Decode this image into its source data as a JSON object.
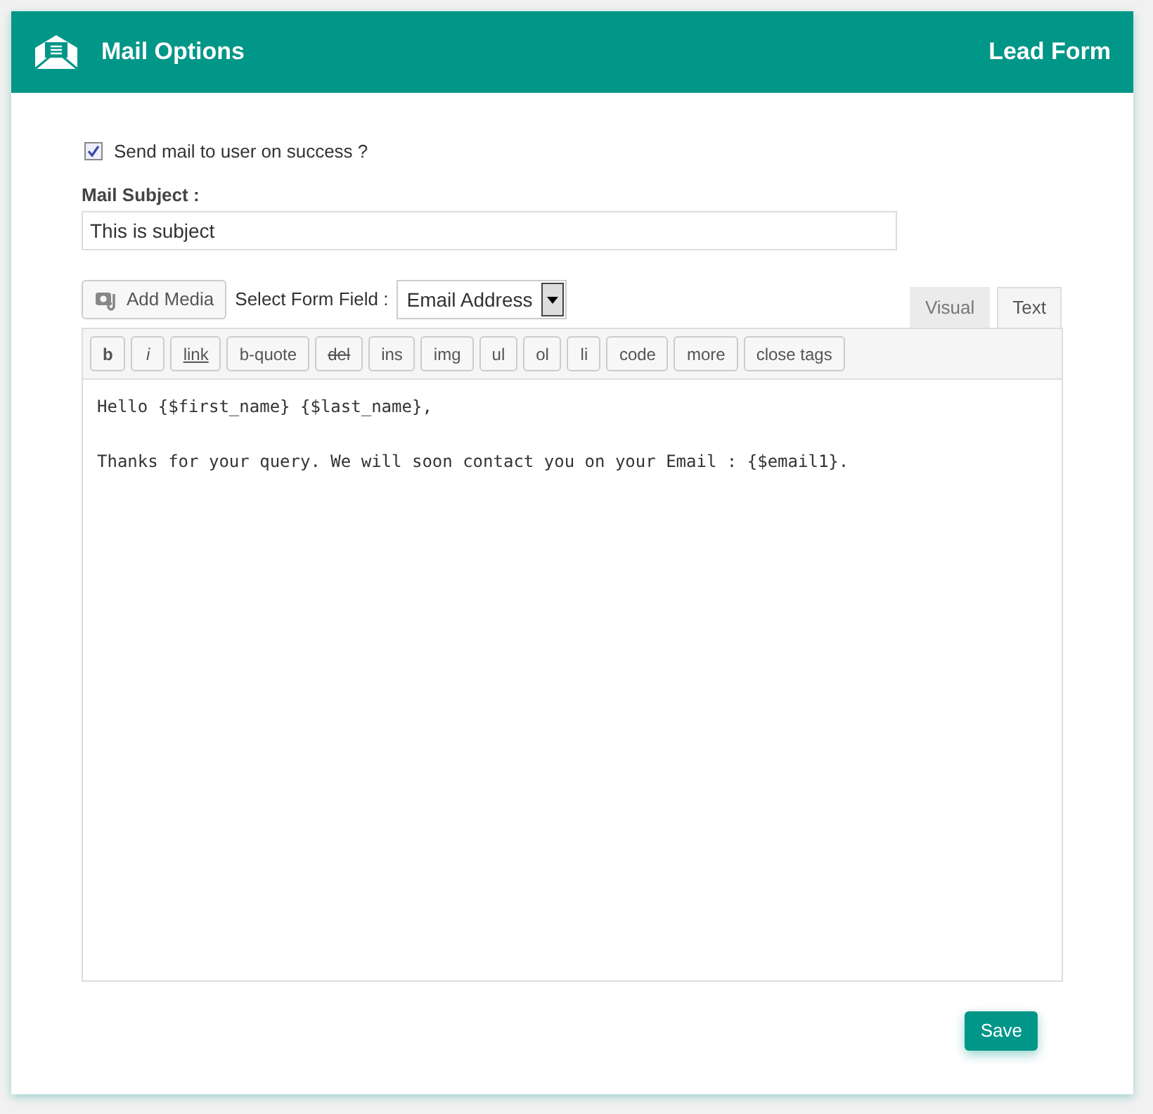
{
  "header": {
    "title": "Mail Options",
    "form_name": "Lead Form"
  },
  "send_mail": {
    "label": "Send mail to user on success ?",
    "checked": true
  },
  "subject": {
    "label": "Mail Subject :",
    "value": "This is subject"
  },
  "add_media": "Add Media",
  "form_field": {
    "label": "Select Form Field :",
    "value": "Email Address"
  },
  "tabs": [
    {
      "label": "Visual",
      "selected": false
    },
    {
      "label": "Text",
      "selected": true
    }
  ],
  "quicktags": [
    {
      "label": "b",
      "kind": "bold"
    },
    {
      "label": "i",
      "kind": "italic"
    },
    {
      "label": "link",
      "kind": "link"
    },
    {
      "label": "b-quote",
      "kind": "plain"
    },
    {
      "label": "del",
      "kind": "strike"
    },
    {
      "label": "ins",
      "kind": "plain"
    },
    {
      "label": "img",
      "kind": "plain"
    },
    {
      "label": "ul",
      "kind": "plain"
    },
    {
      "label": "ol",
      "kind": "plain"
    },
    {
      "label": "li",
      "kind": "plain"
    },
    {
      "label": "code",
      "kind": "plain"
    },
    {
      "label": "more",
      "kind": "plain"
    },
    {
      "label": "close tags",
      "kind": "plain"
    }
  ],
  "editor": {
    "value": "Hello {$first_name} {$last_name},\n\nThanks for your query. We will soon contact you on your Email : {$email1}."
  },
  "save": "Save"
}
